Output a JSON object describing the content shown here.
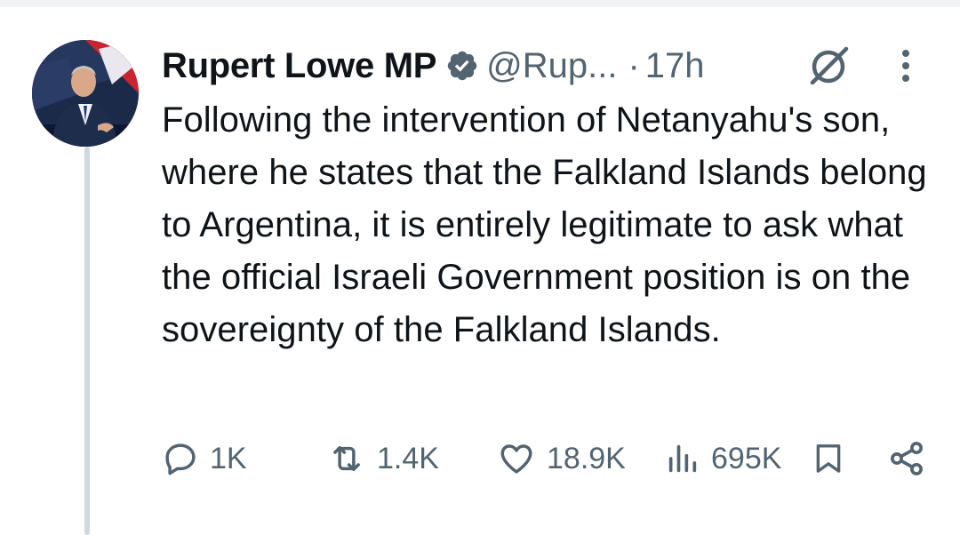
{
  "tweet": {
    "display_name": "Rupert Lowe MP",
    "handle": "@Rup...",
    "separator": "·",
    "time": "17h",
    "text": "Following the intervention of Netanyahu's son, where he states that the Falkland Islands belong to Argentina, it is entirely legitimate to ask what the official Israeli Government position is on the sovereignty of the Falkland Islands."
  },
  "icons": {
    "verified": "verified-badge-icon",
    "grok": "grok-icon",
    "more": "more-vertical-icon",
    "reply": "reply-icon",
    "retweet": "retweet-icon",
    "like": "heart-icon",
    "views": "views-icon",
    "bookmark": "bookmark-icon",
    "share": "share-icon"
  },
  "metrics": {
    "replies": "1K",
    "retweets": "1.4K",
    "likes": "18.9K",
    "views": "695K"
  },
  "colors": {
    "text": "#0f1419",
    "secondary": "#536471",
    "thread_line": "#cfd9de",
    "verified_badge": "#536471"
  }
}
